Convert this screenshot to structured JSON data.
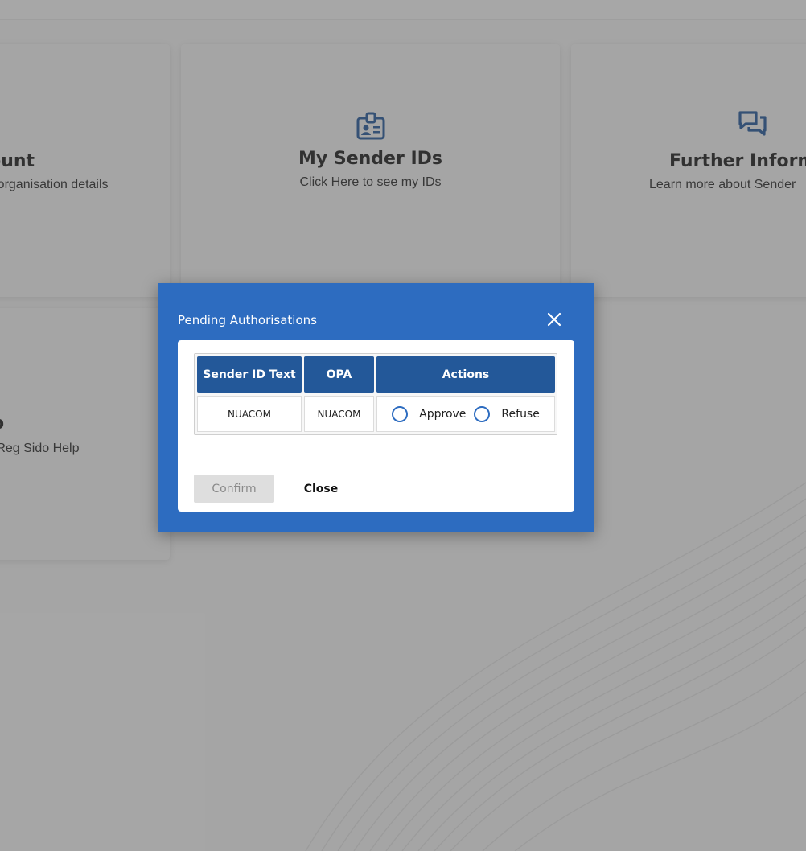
{
  "dashboard": {
    "cards": [
      {
        "title": "ccount",
        "subtitle": "ur organisation details"
      },
      {
        "title": "My Sender IDs",
        "subtitle": "Click Here to see my IDs",
        "icon": "id-badge-icon"
      },
      {
        "title": "Further Informa",
        "subtitle": "Learn more about Sender",
        "icon": "chat-bubbles-icon"
      },
      {
        "title": "o",
        "subtitle": "mReg Sido Help"
      }
    ]
  },
  "modal": {
    "title": "Pending Authorisations",
    "close_icon": "close-icon",
    "table": {
      "headers": [
        "Sender ID Text",
        "OPA",
        "Actions"
      ],
      "rows": [
        {
          "sender_id_text": "NUACOM",
          "opa": "NUACOM",
          "approve_label": "Approve",
          "refuse_label": "Refuse"
        }
      ]
    },
    "confirm_label": "Confirm",
    "close_label": "Close"
  },
  "colors": {
    "modal_blue": "#2d6cc0",
    "header_blue": "#235899",
    "radio_blue": "#2d6cc0"
  }
}
